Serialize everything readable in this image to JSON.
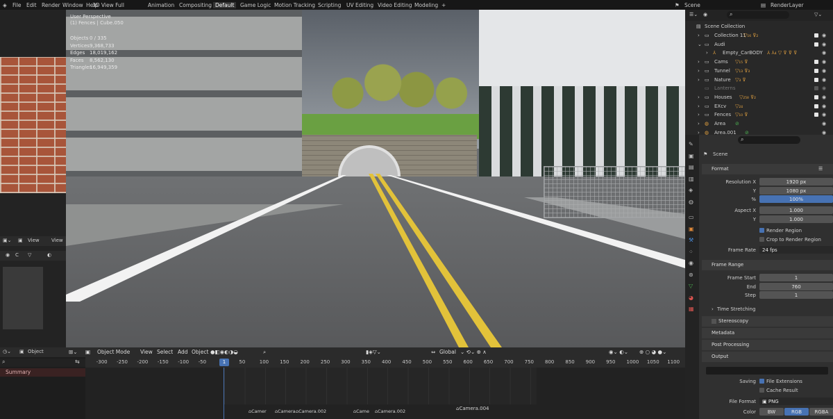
{
  "menubar": {
    "items": [
      "File",
      "Edit",
      "Render",
      "Window",
      "Help"
    ],
    "workspaces": [
      "3D View Full",
      "Animation",
      "Compositing",
      "Default",
      "Game Logic",
      "Motion Tracking",
      "Scripting",
      "UV Editing",
      "Video Editing",
      "Modeling"
    ],
    "active_workspace": "Default",
    "scene": "Scene",
    "view_layer": "RenderLayer"
  },
  "left_panel": {
    "view_label": "View",
    "view_label2": "View",
    "c_label": "C",
    "object_label": "Object",
    "summary": "Summary"
  },
  "viewport": {
    "perspective": "User Perspective",
    "active": "(1) Fences | Cube.050",
    "stats": [
      {
        "k": "Objects",
        "v": "0 / 335"
      },
      {
        "k": "Vertices",
        "v": "9,368,733"
      },
      {
        "k": "Edges",
        "v": "18,019,162"
      },
      {
        "k": "Faces",
        "v": "8,562,130"
      },
      {
        "k": "Triangles",
        "v": "16,949,359"
      }
    ],
    "header": {
      "mode": "Object Mode",
      "view": "View",
      "select": "Select",
      "add": "Add",
      "object": "Object",
      "orientation": "Global"
    }
  },
  "outliner": {
    "root": "Scene Collection",
    "rows": [
      {
        "name": "Collection 11",
        "icons": "▽₁₆ ⊽₂"
      },
      {
        "name": "Audi",
        "icons": ""
      },
      {
        "name": "Empty_CarBODY",
        "icons": "⅄ ⅄₄ ▽ ⊽ ⊽ ⊽"
      },
      {
        "name": "Cams",
        "icons": "▽₁₅ ⊽"
      },
      {
        "name": "Tunnel",
        "icons": "▽₁₃ ⊽₃"
      },
      {
        "name": "Nature",
        "icons": "▽₃ ⊽"
      },
      {
        "name": "Lanterns",
        "icons": ""
      },
      {
        "name": "Houses",
        "icons": "▽₂₅₈ ⊽₂"
      },
      {
        "name": "EXcv",
        "icons": "▽₂₄"
      },
      {
        "name": "Fences",
        "icons": "▽₁₀ ⊽"
      },
      {
        "name": "Area",
        "icons": ""
      },
      {
        "name": "Area.001",
        "icons": ""
      }
    ]
  },
  "properties": {
    "scene": "Scene",
    "format": "Format",
    "resolution_x_label": "Resolution X",
    "resolution_x": "1920 px",
    "y_label": "Y",
    "resolution_y": "1080 px",
    "percent_label": "%",
    "percent": "100%",
    "aspect_x_label": "Aspect X",
    "aspect_x": "1.000",
    "aspect_y_label": "Y",
    "aspect_y": "1.000",
    "render_region": "Render Region",
    "crop_region": "Crop to Render Region",
    "frame_rate_label": "Frame Rate",
    "frame_rate": "24 fps",
    "frame_range": "Frame Range",
    "frame_start_label": "Frame Start",
    "frame_start": "1",
    "end_label": "End",
    "end": "760",
    "step_label": "Step",
    "step": "1",
    "time_stretching": "Time Stretching",
    "stereoscopy": "Stereoscopy",
    "metadata": "Metadata",
    "post_processing": "Post Processing",
    "output": "Output",
    "saving_label": "Saving",
    "file_extensions": "File Extensions",
    "cache_result": "Cache Result",
    "file_format_label": "File Format",
    "file_format": "PNG",
    "color_label": "Color",
    "color_bw": "BW",
    "color_rgb": "RGB",
    "color_rgba": "RGBA"
  },
  "timeline": {
    "ticks": [
      "-300",
      "-250",
      "-200",
      "-150",
      "-100",
      "-50",
      "50",
      "100",
      "150",
      "200",
      "250",
      "300",
      "350",
      "400",
      "450",
      "500",
      "550",
      "600",
      "650",
      "700",
      "750",
      "800",
      "850",
      "900",
      "950",
      "1000",
      "1050",
      "1100"
    ],
    "current_frame": "1",
    "markers": [
      "Camer",
      "Camera.",
      "Camera.002",
      "Came",
      "Camera.002",
      "Camera.004"
    ]
  }
}
